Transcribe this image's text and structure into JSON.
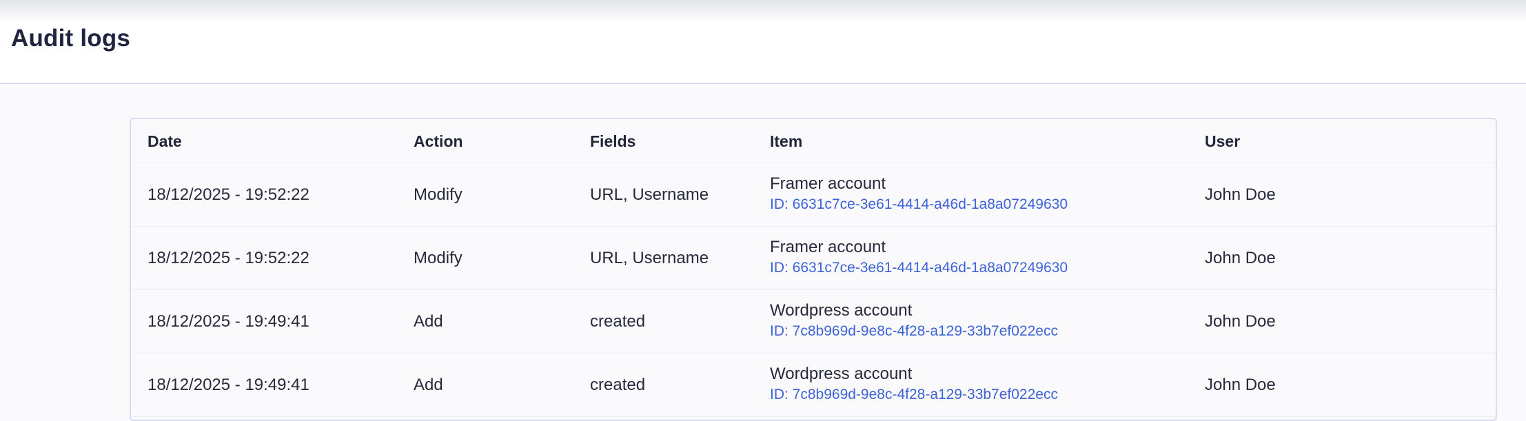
{
  "page": {
    "title": "Audit logs"
  },
  "table": {
    "columns": [
      "Date",
      "Action",
      "Fields",
      "Item",
      "User"
    ],
    "rows": [
      {
        "date": "18/12/2025 - 19:52:22",
        "action": "Modify",
        "fields": "URL, Username",
        "item_name": "Framer account",
        "item_id": "ID: 6631c7ce-3e61-4414-a46d-1a8a07249630",
        "user": "John Doe"
      },
      {
        "date": "18/12/2025 - 19:52:22",
        "action": "Modify",
        "fields": "URL, Username",
        "item_name": "Framer account",
        "item_id": "ID: 6631c7ce-3e61-4414-a46d-1a8a07249630",
        "user": "John Doe"
      },
      {
        "date": "18/12/2025 - 19:49:41",
        "action": "Add",
        "fields": "created",
        "item_name": "Wordpress account",
        "item_id": "ID: 7c8b969d-9e8c-4f28-a129-33b7ef022ecc",
        "user": "John Doe"
      },
      {
        "date": "18/12/2025 - 19:49:41",
        "action": "Add",
        "fields": "created",
        "item_name": "Wordpress account",
        "item_id": "ID: 7c8b969d-9e8c-4f28-a129-33b7ef022ecc",
        "user": "John Doe"
      }
    ]
  },
  "colors": {
    "accent_link": "#3d63d8",
    "text_primary": "#222639",
    "border": "#d9dcef",
    "background": "#fafafd"
  }
}
